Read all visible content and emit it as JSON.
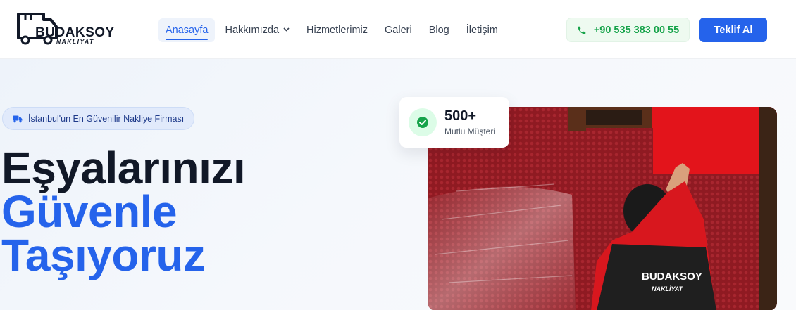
{
  "brand": {
    "name": "BUDAKSOY",
    "tagline": "NAKLİYAT"
  },
  "nav": {
    "items": [
      {
        "label": "Anasayfa",
        "active": true
      },
      {
        "label": "Hakkımızda",
        "dropdown": true
      },
      {
        "label": "Hizmetlerimiz"
      },
      {
        "label": "Galeri"
      },
      {
        "label": "Blog"
      },
      {
        "label": "İletişim"
      }
    ]
  },
  "header": {
    "phone": "+90 535 383 00 55",
    "cta_label": "Teklif Al"
  },
  "hero": {
    "badge": "İstanbul'un En Güvenilir Nakliye Firması",
    "headline_line1": "Eşyalarınızı",
    "headline_line2": "Güvenle",
    "headline_line3": "Taşıyoruz",
    "stat_value": "500+",
    "stat_label": "Mutlu Müşteri",
    "photo_vest_brand": "BUDAKSOY",
    "photo_vest_sub": "NAKLİYAT"
  },
  "colors": {
    "primary": "#2563eb",
    "success": "#16a34a",
    "dark": "#111827"
  },
  "icons": {
    "phone": "phone-icon",
    "badge": "truck-icon",
    "stat": "check-circle-icon",
    "dropdown": "chevron-down-icon"
  }
}
